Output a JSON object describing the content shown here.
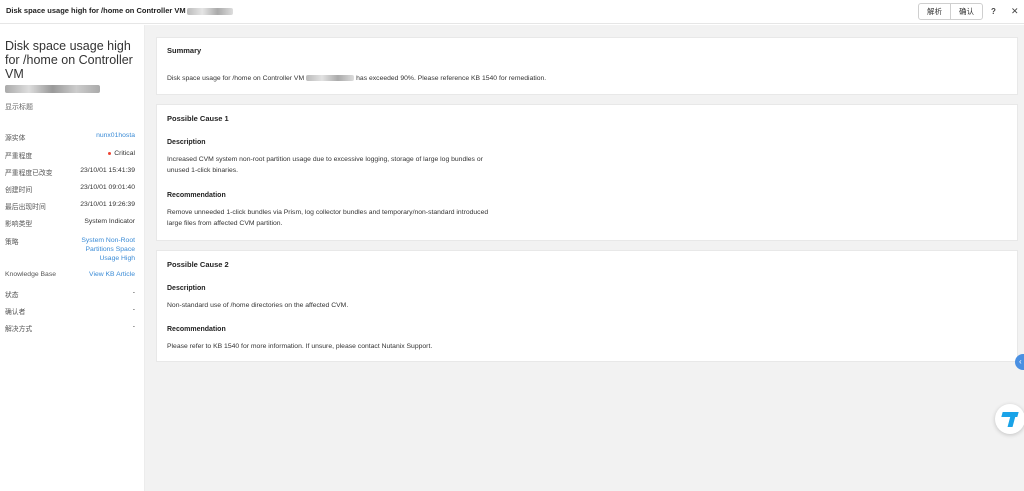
{
  "window": {
    "title": "Disk space usage high for /home on Controller VM",
    "analyze_label": "解析",
    "confirm_label": "确认",
    "help_label": "?",
    "close_label": "✕"
  },
  "sidebar": {
    "title": "Disk space usage high for /home on Controller VM",
    "show_title": "显示标题",
    "source_entity": {
      "key": "源实体",
      "value": "nunx01hosta"
    },
    "severity": {
      "key": "严重程度",
      "value": "Critical"
    },
    "severity_changed": {
      "key": "严重程度已改变",
      "value": "23/10/01 15:41:39"
    },
    "created": {
      "key": "创建时间",
      "value": "23/10/01 09:01:40"
    },
    "last_seen": {
      "key": "最后出现时间",
      "value": "23/10/01 19:26:39"
    },
    "impact_type": {
      "key": "影响类型",
      "value": "System Indicator"
    },
    "policy": {
      "key": "策略",
      "value": "System Non-Root Partitions Space Usage High"
    },
    "knowledge_base": {
      "key": "Knowledge Base",
      "value": "View KB Article"
    },
    "status": {
      "key": "状态",
      "value": "-"
    },
    "acknowledged_by": {
      "key": "确认者",
      "value": "-"
    },
    "resolution": {
      "key": "解决方式",
      "value": "-"
    }
  },
  "summary": {
    "heading": "Summary",
    "text_before": "Disk space usage for /home on Controller VM",
    "text_after": "has exceeded 90%. Please reference KB 1540 for remediation."
  },
  "cause1": {
    "heading": "Possible Cause 1",
    "description_heading": "Description",
    "description": "Increased CVM system non-root partition usage due to excessive logging, storage of large log bundles or unused 1-click binaries.",
    "recommendation_heading": "Recommendation",
    "recommendation": "Remove unneeded 1-click bundles via Prism, log collector bundles and temporary/non-standard introduced large files from affected CVM partition."
  },
  "cause2": {
    "heading": "Possible Cause 2",
    "description_heading": "Description",
    "description": "Non-standard use of /home directories on the affected CVM.",
    "recommendation_heading": "Recommendation",
    "recommendation": "Please refer to KB 1540 for more information. If unsure, please contact Nutanix Support."
  },
  "colors": {
    "link": "#3a8bd6",
    "critical": "#ee4433",
    "background": "#f2f2f2"
  }
}
